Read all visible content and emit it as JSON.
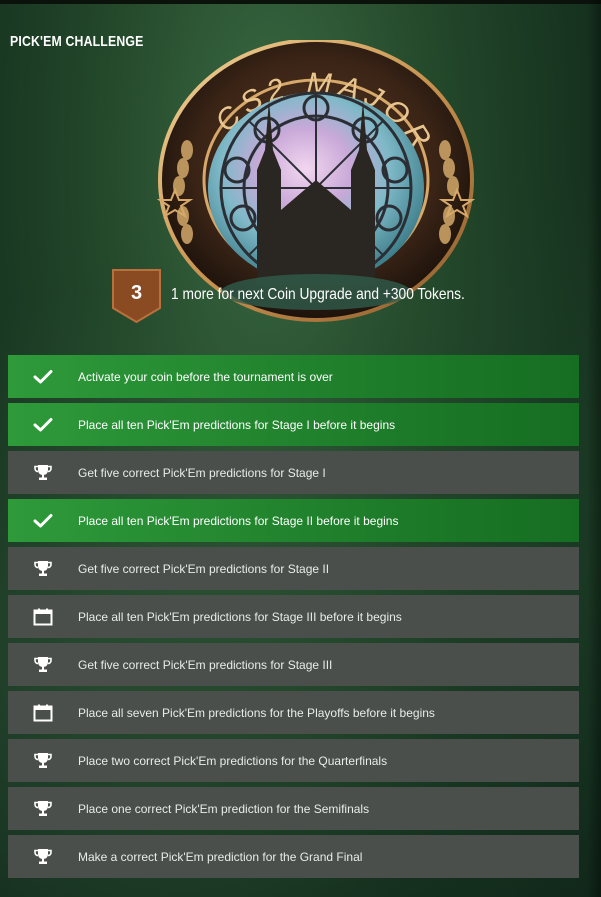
{
  "header": {
    "title": "PICK'EM CHALLENGE"
  },
  "coin": {
    "inscription": "CS2 MAJOR",
    "level": "3",
    "upgrade_text": "1 more for next Coin Upgrade and +300 Tokens."
  },
  "colors": {
    "completed": "#1f8a2e",
    "pending": "#4a4f4b",
    "badge": "#8a4a22"
  },
  "tasks": [
    {
      "label": "Activate your coin before the tournament is over",
      "status": "completed",
      "icon": "check-icon"
    },
    {
      "label": "Place all ten Pick'Em predictions for Stage I before it begins",
      "status": "completed",
      "icon": "check-icon"
    },
    {
      "label": "Get five correct Pick'Em predictions for Stage I",
      "status": "pending",
      "icon": "trophy-icon"
    },
    {
      "label": "Place all ten Pick'Em predictions for Stage II before it begins",
      "status": "completed",
      "icon": "check-icon"
    },
    {
      "label": "Get five correct Pick'Em predictions for Stage II",
      "status": "pending",
      "icon": "trophy-icon"
    },
    {
      "label": "Place all ten Pick'Em predictions for Stage III before it begins",
      "status": "pending",
      "icon": "calendar-icon"
    },
    {
      "label": "Get five correct Pick'Em predictions for Stage III",
      "status": "pending",
      "icon": "trophy-icon"
    },
    {
      "label": "Place all seven Pick'Em predictions for the Playoffs before it begins",
      "status": "pending",
      "icon": "calendar-icon"
    },
    {
      "label": "Place two correct Pick'Em predictions for the Quarterfinals",
      "status": "pending",
      "icon": "trophy-icon"
    },
    {
      "label": "Place one correct Pick'Em prediction for the Semifinals",
      "status": "pending",
      "icon": "trophy-icon"
    },
    {
      "label": "Make a correct Pick'Em prediction for the Grand Final",
      "status": "pending",
      "icon": "trophy-icon"
    }
  ]
}
